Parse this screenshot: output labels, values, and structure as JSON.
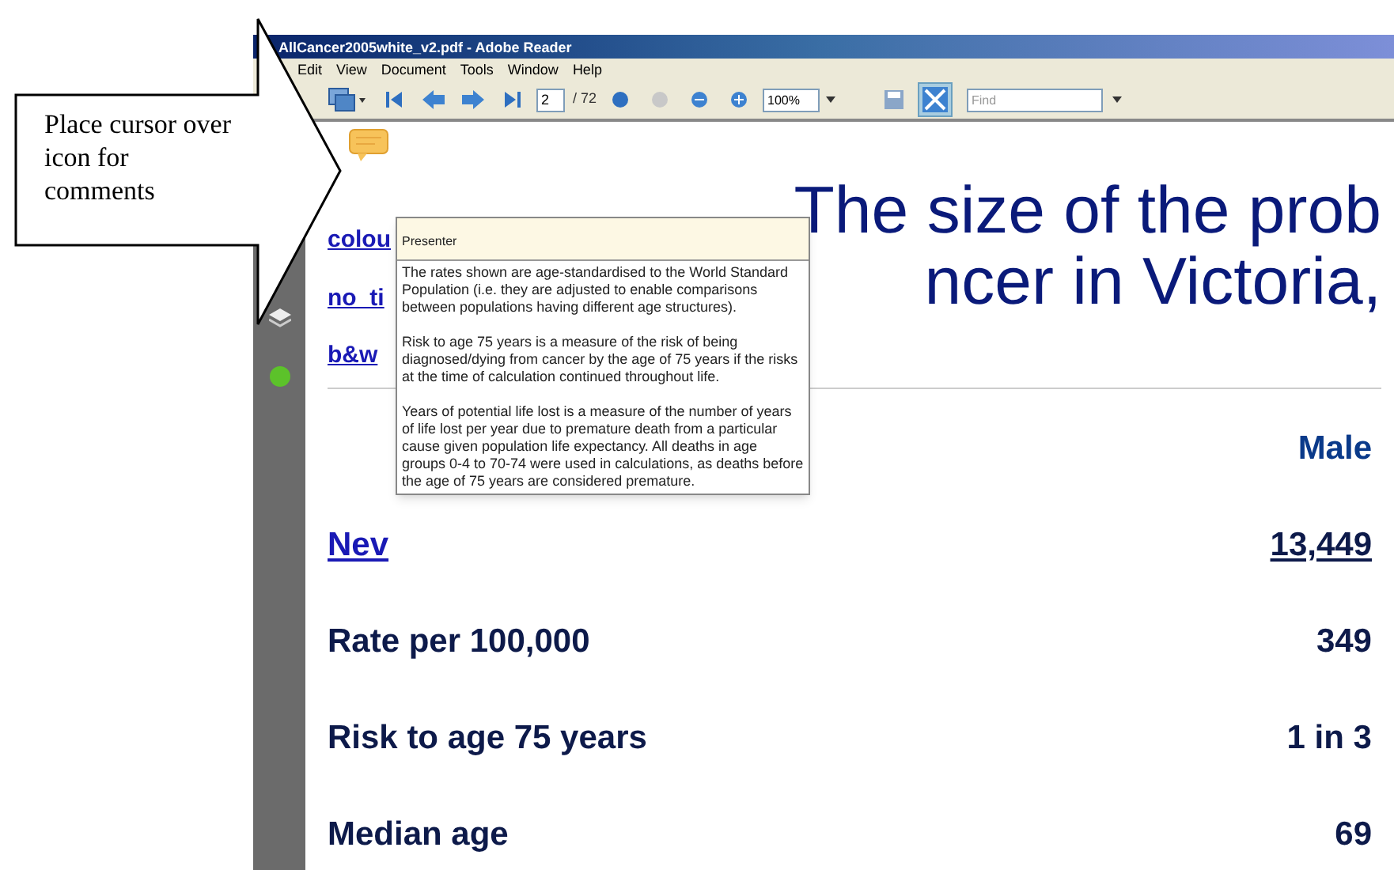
{
  "callout": {
    "text": "Place cursor over icon for comments"
  },
  "window": {
    "title": "AllCancer2005white_v2.pdf - Adobe Reader"
  },
  "menu": [
    "Edit",
    "View",
    "Document",
    "Tools",
    "Window",
    "Help"
  ],
  "toolbar": {
    "page": "2",
    "page_count": "/ 72",
    "zoom": "100%",
    "find": {
      "placeholder": "Find"
    },
    "fit_selected": true
  },
  "document": {
    "title_lines": [
      "The size of the prob",
      "ncer in Victoria,"
    ],
    "links": [
      "colou",
      "no_ti",
      "b&w"
    ],
    "column_header": "Male",
    "rows": [
      {
        "kind": "link",
        "label": "Nev",
        "value": "13,449"
      },
      {
        "kind": "text",
        "label": "Rate per 100,000",
        "value": "349"
      },
      {
        "kind": "text",
        "label": "Risk to age 75 years",
        "value": "1 in 3"
      },
      {
        "kind": "text",
        "label": "Median age",
        "value": "69"
      }
    ]
  },
  "comment": {
    "author": "Presenter",
    "paragraphs": [
      "The rates shown are age-standardised to the World Standard Population (i.e. they are adjusted to enable comparisons between populations having different age structures).",
      "Risk to age 75 years is a measure of the risk of being diagnosed/dying from cancer by the age of 75 years if the risks at the time of calculation continued throughout life.",
      "Years of potential life lost is a measure of the number of years of life lost per year due to premature death from a particular cause given population life expectancy. All deaths in age groups 0-4 to 70-74 were used in calculations, as deaths before the age of 75 years are considered premature."
    ]
  }
}
